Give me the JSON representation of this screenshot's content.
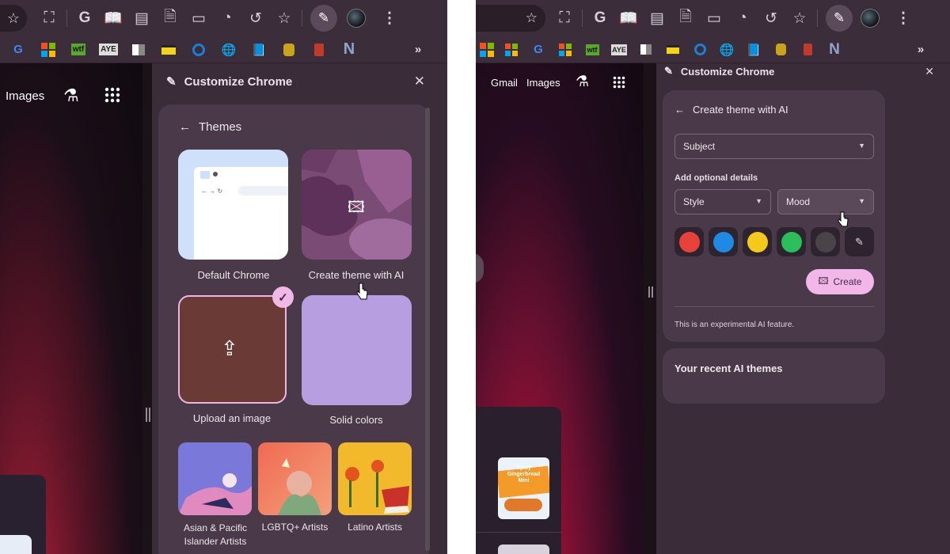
{
  "left": {
    "toolbar_icons": [
      "star-icon",
      "extension-off-icon",
      "google-icon",
      "reading-mode-icon",
      "notes-icon",
      "document-icon",
      "label-icon",
      "speed-icon",
      "history-icon",
      "bookmark-star-icon",
      "edit-icon",
      "profile-avatar",
      "more-menu-icon"
    ],
    "page": {
      "images_link": "Images"
    },
    "panel": {
      "title": "Customize Chrome",
      "section_title": "Themes",
      "tiles": [
        {
          "label": "Default Chrome"
        },
        {
          "label": "Create theme with AI"
        },
        {
          "label": "Upload an image"
        },
        {
          "label": "Solid colors"
        }
      ],
      "collections": [
        {
          "label": "Asian & Pacific Islander Artists"
        },
        {
          "label": "LGBTQ+ Artists"
        },
        {
          "label": "Latino Artists"
        }
      ]
    }
  },
  "right": {
    "page": {
      "gmail_link": "Gmail",
      "images_link": "Images",
      "promo_line1": "Spicy",
      "promo_line2": "Gingerbread",
      "promo_line3": "Mini"
    },
    "panel": {
      "title": "Customize Chrome",
      "section_title": "Create theme with AI",
      "subject_placeholder": "Subject",
      "optional_label": "Add optional details",
      "style_label": "Style",
      "mood_label": "Mood",
      "colors": [
        "#e8413a",
        "#1f8ae3",
        "#f4c91c",
        "#2bbf5c",
        "#4a4449"
      ],
      "create_label": "Create",
      "disclaimer": "This is an experimental AI feature.",
      "recent_title": "Your recent AI themes"
    }
  }
}
